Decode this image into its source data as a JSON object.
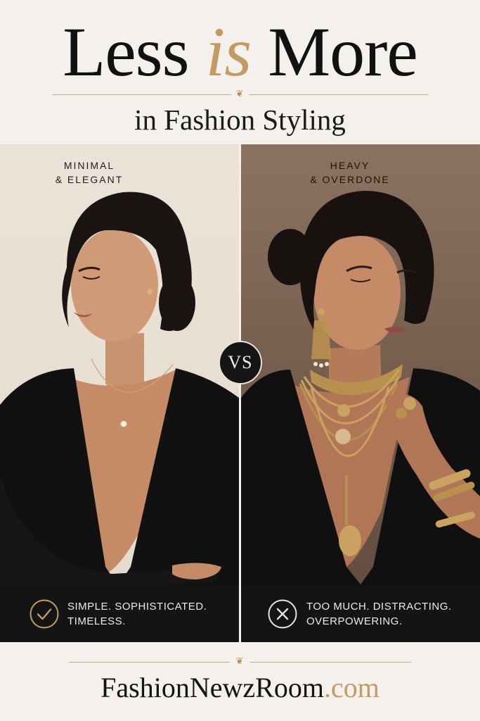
{
  "header": {
    "title_part1": "Less",
    "title_accent": "is",
    "title_part2": "More",
    "subtitle": "in Fashion Styling"
  },
  "left_panel": {
    "label_line1": "MINIMAL",
    "label_line2": "& ELEGANT",
    "caption_line1": "SIMPLE. SOPHISTICATED.",
    "caption_line2": "TIMELESS.",
    "caption_icon": "check-circle-icon"
  },
  "right_panel": {
    "label_line1": "HEAVY",
    "label_line2": "& OVERDONE",
    "caption_line1": "TOO MUCH. DISTRACTING.",
    "caption_line2": "OVERPOWERING.",
    "caption_icon": "x-circle-icon"
  },
  "vs_badge": "VS",
  "footer": {
    "brand_name": "FashionNewzRoom",
    "brand_tld": ".com"
  },
  "colors": {
    "accent_gold": "#c49a63",
    "dark": "#141414",
    "cream": "#f4f0eb"
  }
}
